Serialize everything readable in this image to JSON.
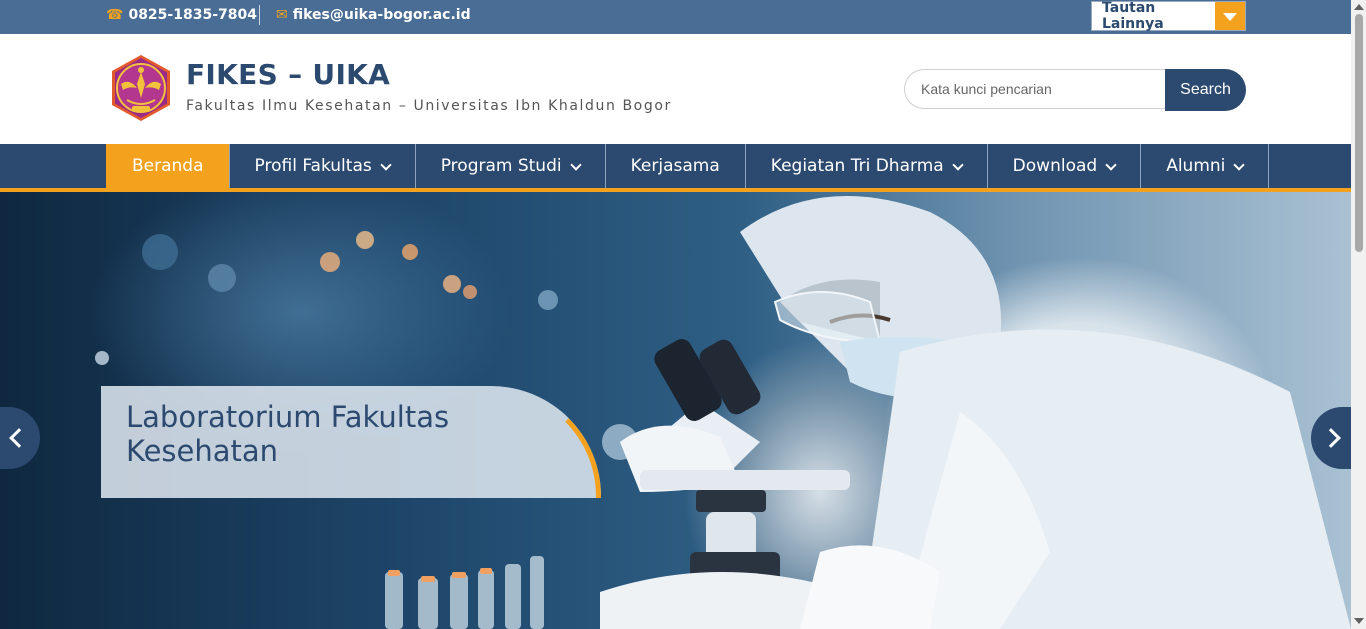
{
  "topbar": {
    "phone": "0825-1835-7804",
    "email": "fikes@uika-bogor.ac.id",
    "links_dropdown": "Tautan Lainnya"
  },
  "header": {
    "logo_icon": "university-seal-logo",
    "title": "FIKES – UIKA",
    "tagline": "Fakultas Ilmu Kesehatan – Universitas Ibn Khaldun Bogor"
  },
  "search": {
    "placeholder": "Kata kunci pencarian",
    "button": "Search"
  },
  "nav": {
    "items": [
      {
        "label": "Beranda",
        "active": true
      },
      {
        "label": "Profil Fakultas",
        "dropdown": true
      },
      {
        "label": "Program Studi",
        "dropdown": true
      },
      {
        "label": "Kerjasama",
        "dropdown": false
      },
      {
        "label": "Kegiatan Tri Dharma",
        "dropdown": true
      },
      {
        "label": "Download",
        "dropdown": true
      },
      {
        "label": "Alumni",
        "dropdown": true
      }
    ]
  },
  "hero": {
    "caption": "Laboratorium Fakultas Kesehatan",
    "prev_icon": "chevron-left-icon",
    "next_icon": "chevron-right-icon"
  },
  "colors": {
    "primary": "#2c4a70",
    "topbar": "#4a6d95",
    "accent": "#f4a21d"
  }
}
